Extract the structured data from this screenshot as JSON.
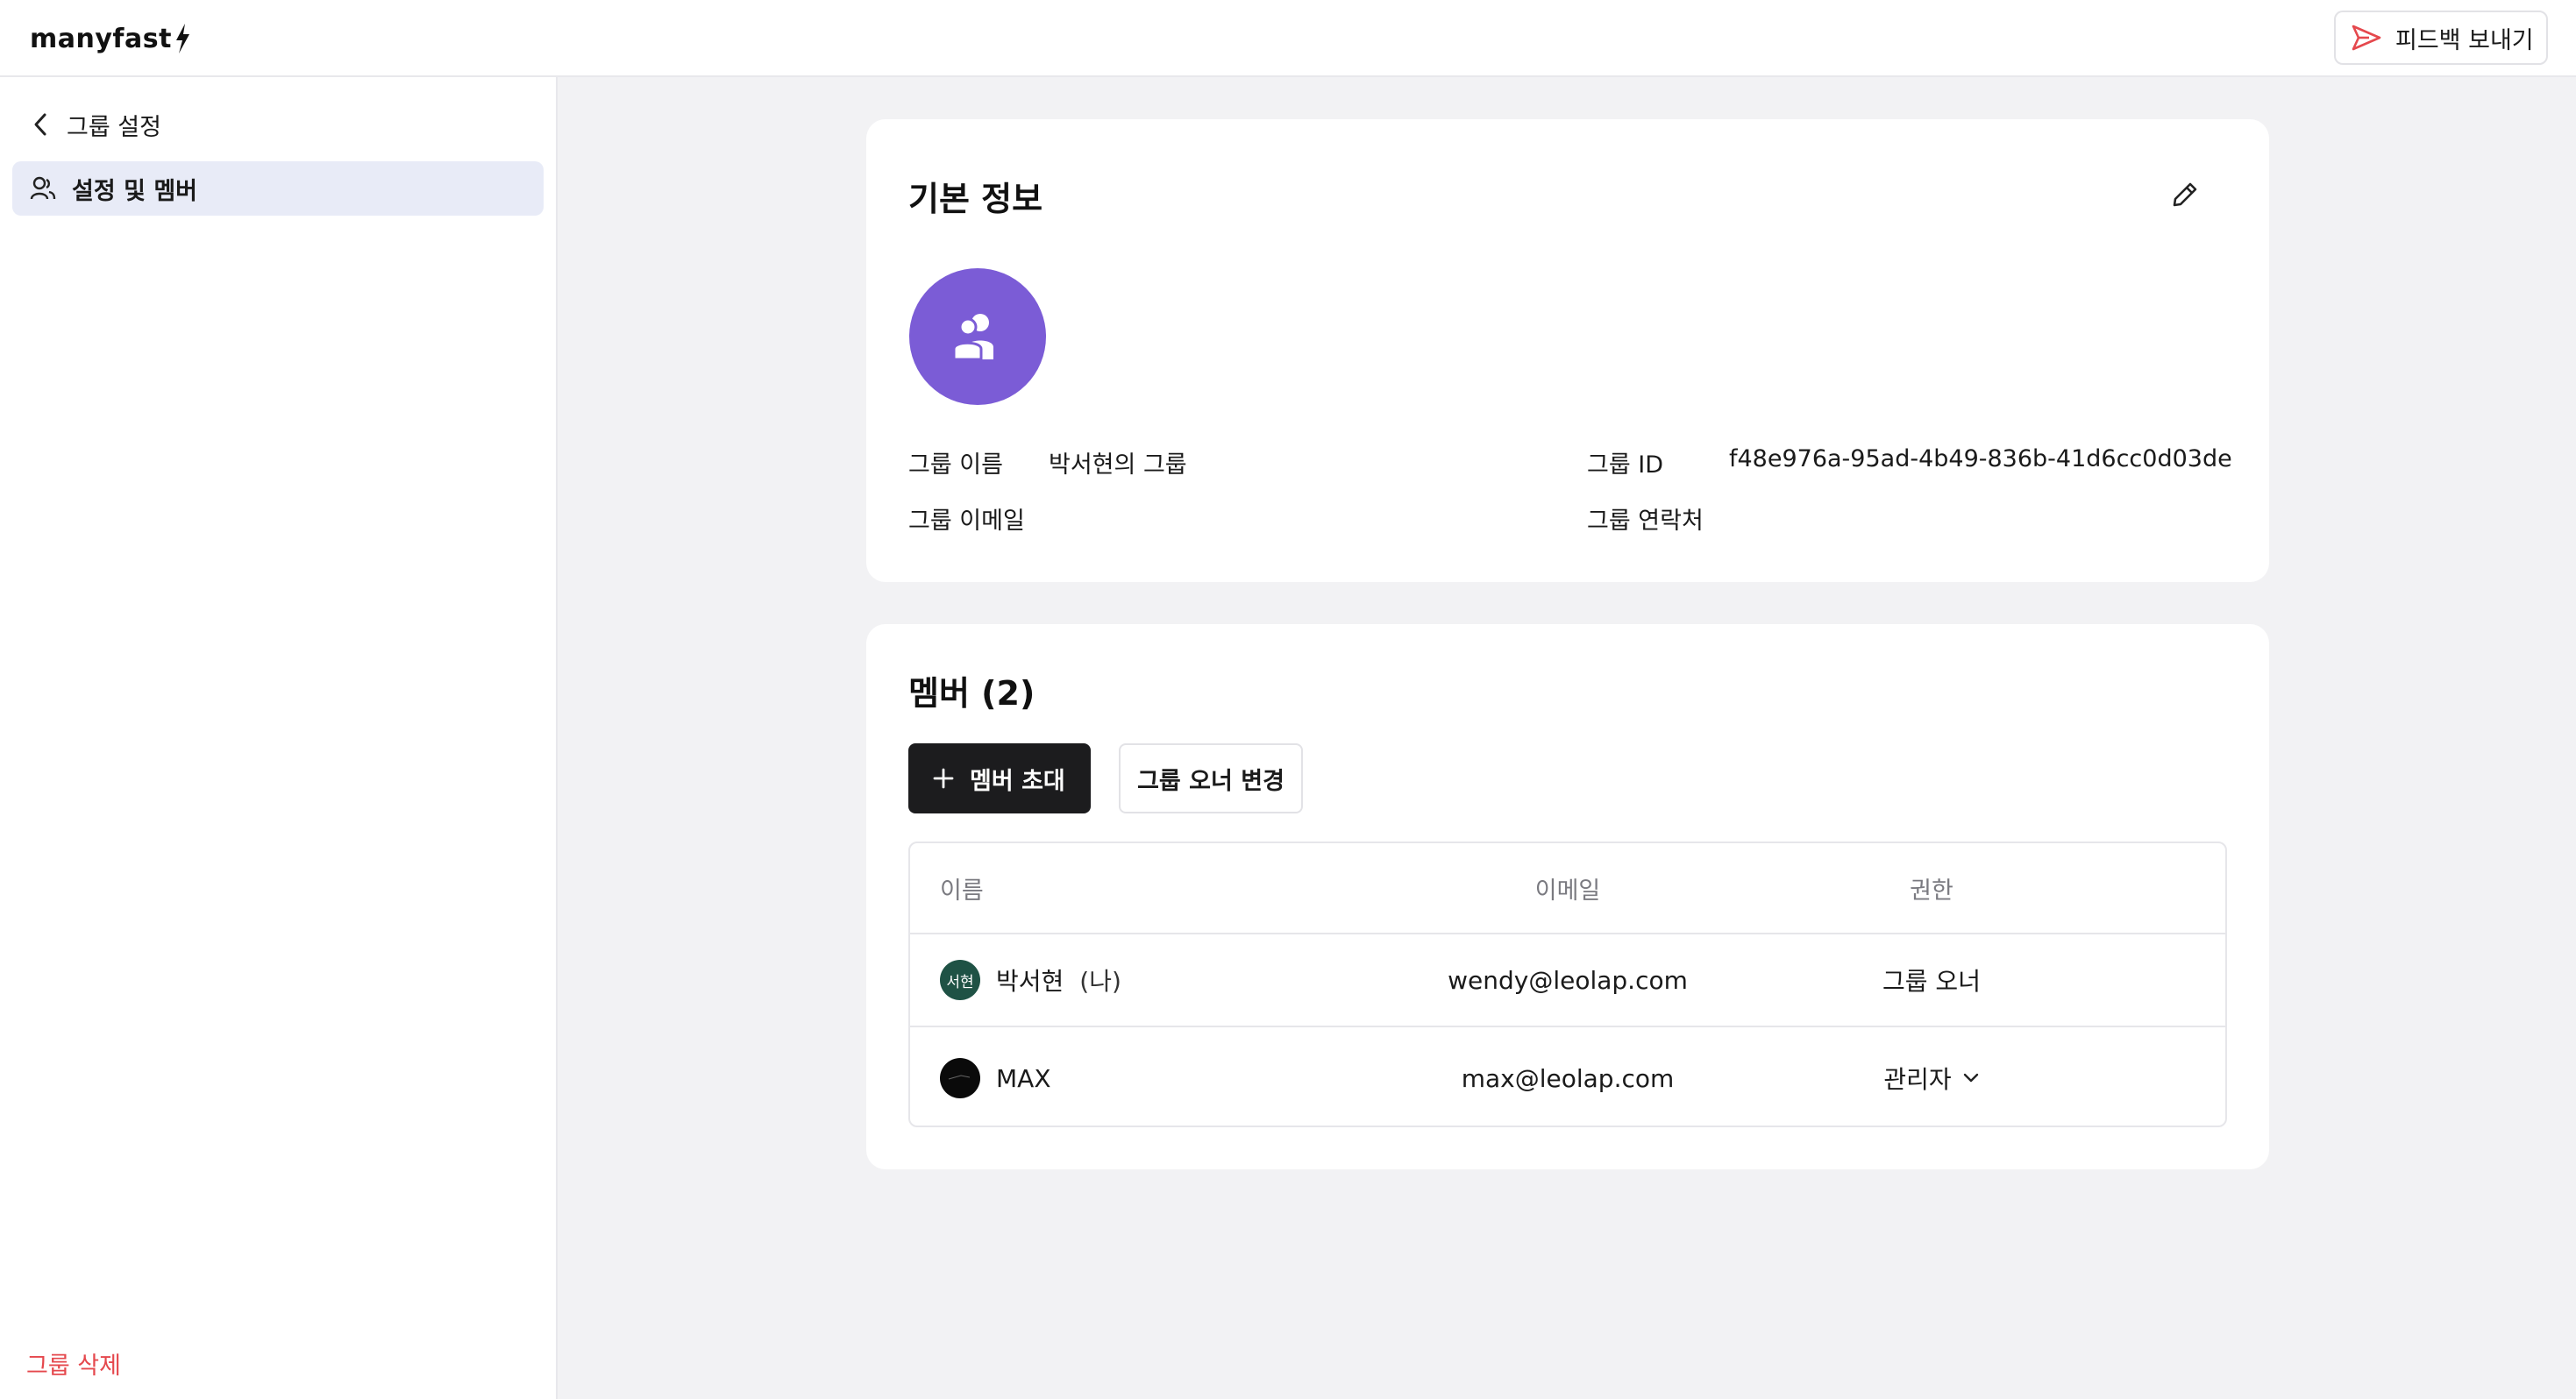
{
  "header": {
    "logo_text": "manyfast",
    "feedback_label": "피드백 보내기"
  },
  "sidebar": {
    "back_label": "그룹 설정",
    "items": [
      {
        "label": "설정 및 멤버",
        "icon": "user-group-icon",
        "active": true
      }
    ],
    "delete_label": "그룹 삭제"
  },
  "info": {
    "title": "기본 정보",
    "avatar_color": "#7b5cd6",
    "fields": {
      "name_label": "그룹 이름",
      "name_value": "박서현의 그룹",
      "id_label": "그룹 ID",
      "id_value": "f48e976a-95ad-4b49-836b-41d6cc0d03de",
      "email_label": "그룹 이메일",
      "email_value": "",
      "contact_label": "그룹 연락처",
      "contact_value": ""
    }
  },
  "members": {
    "title": "멤버 (2)",
    "invite_label": "멤버 초대",
    "change_owner_label": "그룹 오너 변경",
    "columns": [
      "이름",
      "이메일",
      "권한"
    ],
    "rows": [
      {
        "avatar_text": "서현",
        "name": "박서현",
        "me_tag": "(나)",
        "email": "wendy@leolap.com",
        "role": "그룹 오너",
        "role_editable": false
      },
      {
        "avatar_text": "",
        "name": "MAX",
        "me_tag": "",
        "email": "max@leolap.com",
        "role": "관리자",
        "role_editable": true
      }
    ]
  },
  "colors": {
    "accent_purple": "#7b5cd6",
    "danger": "#e5484d",
    "primary_button": "#1c1c1e",
    "active_nav": "#e8ebf7"
  }
}
